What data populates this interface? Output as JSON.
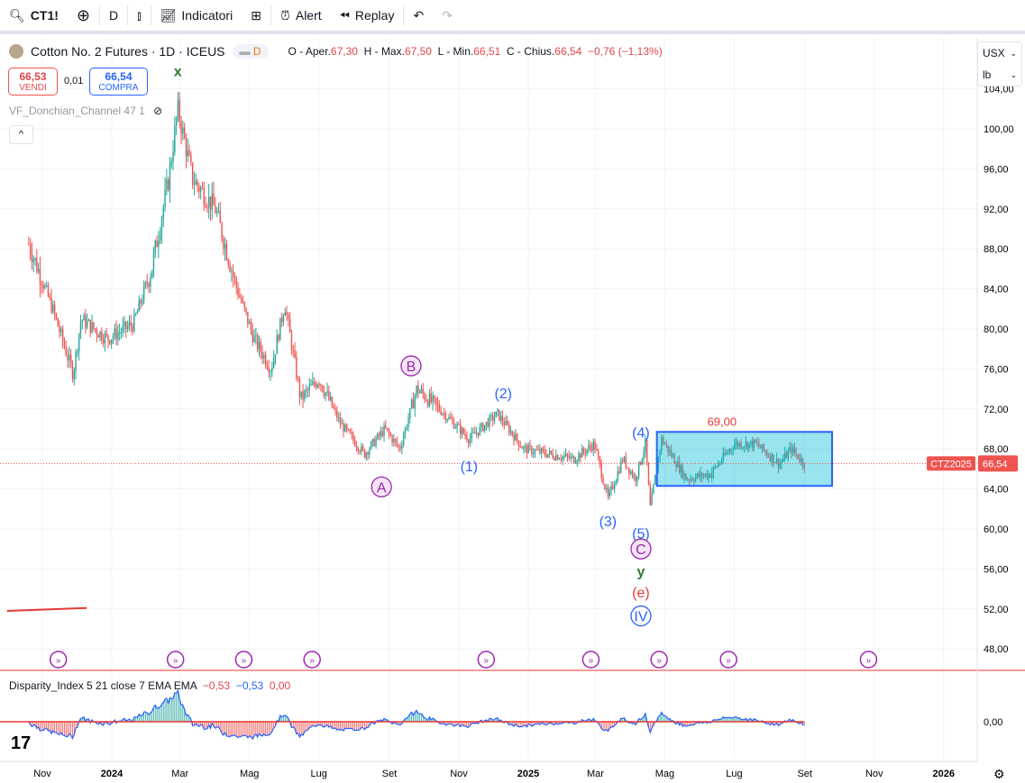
{
  "toolbar": {
    "symbol": "CT1!",
    "interval": "D",
    "indicators": "Indicatori",
    "alert": "Alert",
    "replay": "Replay"
  },
  "legend": {
    "title": "Cotton No. 2 Futures · 1D · ICEUS",
    "badge": "D",
    "o_label": "O - Aper.",
    "o": "67,30",
    "h_label": "H - Max.",
    "h": "67,50",
    "l_label": "L - Min.",
    "l": "66,51",
    "c_label": "C - Chius.",
    "c": "66,54",
    "change": "−0,76 (−1,13%)"
  },
  "trade": {
    "sell_price": "66,53",
    "sell_label": "VENDI",
    "spread": "0,01",
    "buy_price": "66,54",
    "buy_label": "COMPRA"
  },
  "indicator": {
    "name": "VF_Donchian_Channel 47 1"
  },
  "units": {
    "currency": "USX",
    "unit": "lb"
  },
  "price_tag": {
    "symbol": "CTZ2025",
    "value": "66,54"
  },
  "disparity": {
    "name": "Disparity_Index 5 21 close 7 EMA EMA",
    "v1": "−0,53",
    "v2": "−0,53",
    "v3": "0,00",
    "zero": "0,00"
  },
  "colors": {
    "up": "#26a69a",
    "down": "#ef5350",
    "blue": "#2962ff",
    "purple": "#9c27b0",
    "green": "#2e7d32",
    "red": "#e53935"
  },
  "chart_data": {
    "type": "candlestick",
    "y_ticks": [
      "48,00",
      "52,00",
      "56,00",
      "60,00",
      "64,00",
      "68,00",
      "72,00",
      "76,00",
      "80,00",
      "84,00",
      "88,00",
      "92,00",
      "96,00",
      "100,00",
      "104,00"
    ],
    "ylim": [
      48,
      104
    ],
    "x_ticks": [
      {
        "d": "2023-11-01",
        "t": "Nov"
      },
      {
        "d": "2024-01-01",
        "t": "2024"
      },
      {
        "d": "2024-03-01",
        "t": "Mar"
      },
      {
        "d": "2024-05-01",
        "t": "Mag"
      },
      {
        "d": "2024-07-01",
        "t": "Lug"
      },
      {
        "d": "2024-09-01",
        "t": "Set"
      },
      {
        "d": "2024-11-01",
        "t": "Nov"
      },
      {
        "d": "2025-01-01",
        "t": "2025"
      },
      {
        "d": "2025-03-01",
        "t": "Mar"
      },
      {
        "d": "2025-05-01",
        "t": "Mag"
      },
      {
        "d": "2025-07-01",
        "t": "Lug"
      },
      {
        "d": "2025-09-01",
        "t": "Set"
      },
      {
        "d": "2025-11-01",
        "t": "Nov"
      },
      {
        "d": "2026-01-01",
        "t": "2026"
      }
    ],
    "path": [
      [
        "2023-10-20",
        88.5
      ],
      [
        "2023-11-10",
        82
      ],
      [
        "2023-11-28",
        75.5
      ],
      [
        "2023-12-05",
        81
      ],
      [
        "2023-12-28",
        79
      ],
      [
        "2024-01-20",
        80.5
      ],
      [
        "2024-02-05",
        86
      ],
      [
        "2024-02-20",
        95
      ],
      [
        "2024-02-28",
        102
      ],
      [
        "2024-03-12",
        95
      ],
      [
        "2024-04-01",
        92
      ],
      [
        "2024-04-20",
        84
      ],
      [
        "2024-05-05",
        79
      ],
      [
        "2024-05-20",
        76
      ],
      [
        "2024-06-01",
        82.5
      ],
      [
        "2024-06-15",
        73
      ],
      [
        "2024-07-01",
        75
      ],
      [
        "2024-07-20",
        70.5
      ],
      [
        "2024-08-10",
        67.5
      ],
      [
        "2024-08-28",
        70
      ],
      [
        "2024-09-10",
        68
      ],
      [
        "2024-09-25",
        74
      ],
      [
        "2024-10-15",
        72
      ],
      [
        "2024-11-10",
        69
      ],
      [
        "2024-12-05",
        71.5
      ],
      [
        "2024-12-28",
        68
      ],
      [
        "2025-02-10",
        67
      ],
      [
        "2025-02-28",
        68.5
      ],
      [
        "2025-03-12",
        63
      ],
      [
        "2025-03-25",
        67
      ],
      [
        "2025-04-05",
        65
      ],
      [
        "2025-04-14",
        68.5
      ],
      [
        "2025-04-18",
        62
      ],
      [
        "2025-04-28",
        69
      ],
      [
        "2025-05-20",
        65
      ],
      [
        "2025-06-10",
        65.5
      ],
      [
        "2025-07-01",
        68.5
      ],
      [
        "2025-07-20",
        68.5
      ],
      [
        "2025-08-10",
        66.5
      ],
      [
        "2025-08-20",
        68
      ],
      [
        "2025-09-01",
        66.5
      ]
    ],
    "annotations": [
      {
        "text": "x",
        "d": "2024-02-28",
        "p": 105.8,
        "style": "green"
      },
      {
        "text": "B",
        "d": "2024-09-20",
        "p": 76.3,
        "style": "circle-purple"
      },
      {
        "text": "A",
        "d": "2024-08-25",
        "p": 64.2,
        "style": "circle-purple"
      },
      {
        "text": "(2)",
        "d": "2024-12-10",
        "p": 73.6,
        "style": "blue"
      },
      {
        "text": "(1)",
        "d": "2024-11-10",
        "p": 66.3,
        "style": "blue"
      },
      {
        "text": "(3)",
        "d": "2025-03-12",
        "p": 60.8,
        "style": "blue"
      },
      {
        "text": "(4)",
        "d": "2025-04-10",
        "p": 69.7,
        "style": "blue"
      },
      {
        "text": "(5)",
        "d": "2025-04-10",
        "p": 59.6,
        "style": "blue"
      },
      {
        "text": "C",
        "d": "2025-04-10",
        "p": 58,
        "style": "circle-purple"
      },
      {
        "text": "y",
        "d": "2025-04-10",
        "p": 55.8,
        "style": "green"
      },
      {
        "text": "(e)",
        "d": "2025-04-10",
        "p": 53.7,
        "style": "red"
      },
      {
        "text": "IV",
        "d": "2025-04-10",
        "p": 51.3,
        "style": "circle-blue"
      }
    ],
    "box": {
      "d1": "2025-04-24",
      "d2": "2025-09-25",
      "p1": 64.3,
      "p2": 69.7,
      "label": "69,00"
    },
    "red_line": {
      "d1": "2023-10-01",
      "d2": "2023-12-10",
      "p1": 51.8,
      "p2": 52.1
    },
    "event_markers": [
      "2023-11-15",
      "2024-02-26",
      "2024-04-26",
      "2024-06-25",
      "2024-11-25",
      "2025-02-25",
      "2025-04-26",
      "2025-06-26",
      "2025-10-27"
    ]
  }
}
